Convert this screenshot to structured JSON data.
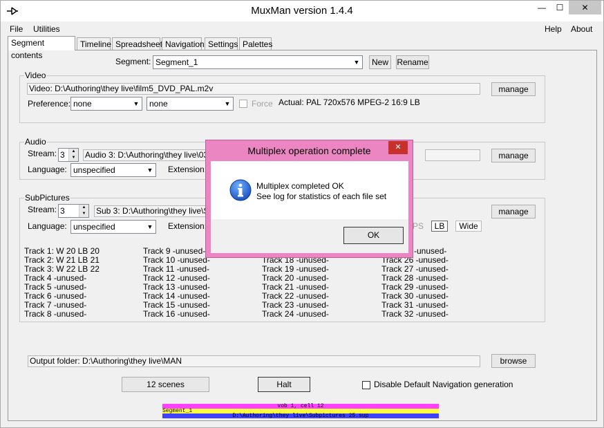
{
  "window": {
    "title": "MuxMan version 1.4.4",
    "min_glyph": "—",
    "max_glyph": "☐",
    "close_glyph": "✕"
  },
  "menu": {
    "file": "File",
    "utilities": "Utilities",
    "help": "Help",
    "about": "About"
  },
  "tabs": [
    "Segment contents",
    "Timeline",
    "Spreadsheet",
    "Navigation",
    "Settings",
    "Palettes"
  ],
  "segment": {
    "label": "Segment:",
    "value": "Segment_1",
    "new_label": "New",
    "rename_label": "Rename"
  },
  "video": {
    "group_title": "Video",
    "file": "Video: D:\\Authoring\\they live\\film5_DVD_PAL.m2v",
    "manage_label": "manage",
    "preference_label": "Preference:",
    "pref1": "none",
    "pref2": "none",
    "force_label": "Force",
    "actual": "Actual: PAL  720x576  MPEG-2  16:9 LB"
  },
  "audio": {
    "group_title": "Audio",
    "stream_label": "Stream:",
    "stream_value": "3",
    "file": "Audio 3: D:\\Authoring\\they live\\03 en",
    "manage_label": "manage",
    "language_label": "Language:",
    "language_value": "unspecified",
    "extension_label": "Extension:"
  },
  "subpictures": {
    "group_title": "SubPictures",
    "stream_label": "Stream:",
    "stream_value": "3",
    "file": "Sub 3: D:\\Authoring\\they live\\Sub",
    "manage_label": "manage",
    "language_label": "Language:",
    "language_value": "unspecified",
    "extension_label": "Extension:",
    "ps_label": "PS",
    "lb_label": "LB",
    "wide_label": "Wide",
    "tracks_col1": [
      "Track 1:  W 20  LB 20",
      "Track 2:  W 21  LB 21",
      "Track 3:  W 22  LB 22",
      "Track 4  -unused-",
      "Track 5  -unused-",
      "Track 6  -unused-",
      "Track 7  -unused-",
      "Track 8  -unused-"
    ],
    "tracks_col2": [
      "Track 9  -unused-",
      "Track 10  -unused-",
      "Track 11  -unused-",
      "Track 12  -unused-",
      "Track 13  -unused-",
      "Track 14  -unused-",
      "Track 15  -unused-",
      "Track 16  -unused-"
    ],
    "tracks_col3": [
      "",
      "Track 18  -unused-",
      "Track 19  -unused-",
      "Track 20  -unused-",
      "Track 21  -unused-",
      "Track 22  -unused-",
      "Track 23  -unused-",
      "Track 24  -unused-"
    ],
    "tracks_col4": [
      "-unused-",
      "Track 26  -unused-",
      "Track 27  -unused-",
      "Track 28  -unused-",
      "Track 29  -unused-",
      "Track 30  -unused-",
      "Track 31  -unused-",
      "Track 32  -unused-"
    ]
  },
  "output": {
    "folder": "Output folder: D:\\Authoring\\they live\\MAN",
    "browse_label": "browse"
  },
  "bottom": {
    "scenes_label": "12 scenes",
    "halt_label": "Halt",
    "disable_nav_label": "Disable Default Navigation generation"
  },
  "progress": {
    "line1": "vob 1, cell 12",
    "line2": "Segment_1",
    "line3": "D:\\Authoring\\they live\\Subpictures 25.sup",
    "colors": [
      "#ff40ff",
      "#ffff40",
      "#4040ff"
    ]
  },
  "dialog": {
    "title": "Multiplex operation complete",
    "message1": "Multiplex completed OK",
    "message2": "See log for statistics of each file set",
    "ok_label": "OK",
    "icon": "info-icon"
  }
}
